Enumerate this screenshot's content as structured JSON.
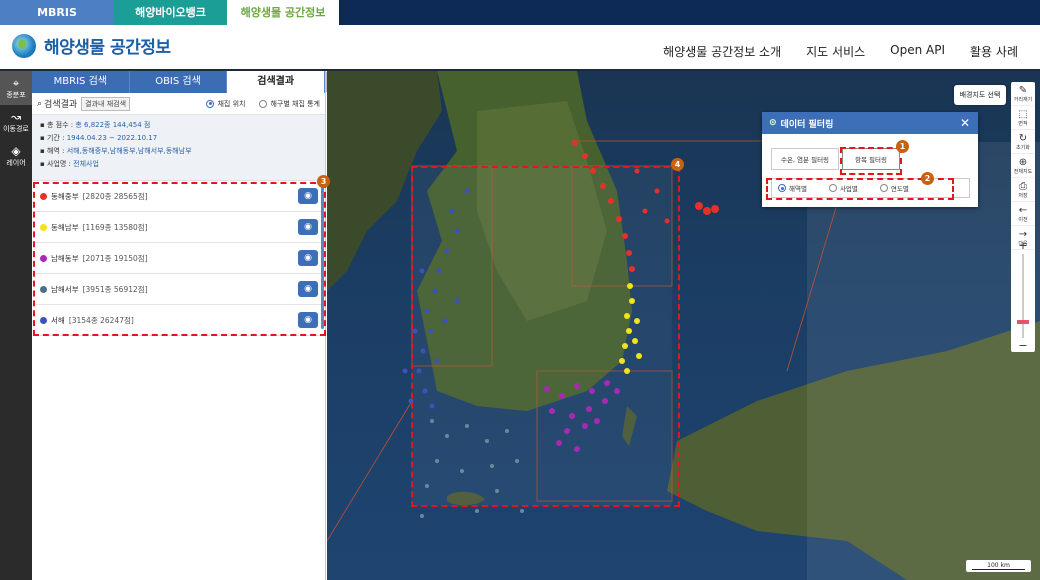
{
  "top_tabs": [
    "MBRIS",
    "해양바이오뱅크",
    "해양생물 공간정보"
  ],
  "logo_text": "해양생물 공간정보",
  "main_nav": [
    "해양생물 공간정보 소개",
    "지도 서비스",
    "Open API",
    "활용 사례"
  ],
  "rail": [
    {
      "label": "종분포",
      "icon": "map-pin-icon"
    },
    {
      "label": "이동경로",
      "icon": "route-icon"
    },
    {
      "label": "레이어",
      "icon": "layers-icon"
    }
  ],
  "panel": {
    "tabs": [
      "MBRIS 검색",
      "OBIS 검색",
      "검색결과"
    ],
    "search_label": "검색결과",
    "research_button": "결과내 재검색",
    "radio_options": [
      "채집 위치",
      "해구별 채집 통계"
    ],
    "summary": [
      {
        "label": "총 점수 : ",
        "value": "총 6,822종 144,454 점"
      },
      {
        "label": "기간 : ",
        "value": "1944.04.23 ~ 2022.10.17"
      },
      {
        "label": "해역 : ",
        "value": "서해,동해중부,남해동부,남해서부,동해남부"
      },
      {
        "label": "사업명 : ",
        "value": "전체사업"
      }
    ],
    "regions": [
      {
        "name": "동해중부",
        "count": "[2820종 28565점]",
        "color": "#e8302a"
      },
      {
        "name": "동해남부",
        "count": "[1169종 13580점]",
        "color": "#f2e31b"
      },
      {
        "name": "남해동부",
        "count": "[2071종 19150점]",
        "color": "#a52bb5"
      },
      {
        "name": "남해서부",
        "count": "[3951종 56912점]",
        "color": "#4a6f88"
      },
      {
        "name": "서해",
        "count": "[3154종 26247점]",
        "color": "#3d52b8"
      }
    ]
  },
  "map": {
    "basemap_button": "배경지도 선택",
    "tools": [
      {
        "label": "거리재기",
        "icon": "ruler-icon"
      },
      {
        "label": "면적",
        "icon": "area-icon"
      },
      {
        "label": "초기화",
        "icon": "refresh-icon"
      },
      {
        "label": "전체지도",
        "icon": "globe-icon"
      },
      {
        "label": "저장",
        "icon": "save-icon"
      },
      {
        "label": "이전",
        "icon": "arrow-left-icon"
      },
      {
        "label": "다음",
        "icon": "arrow-right-icon"
      }
    ],
    "scale": "100 km"
  },
  "filter_popup": {
    "title": "데이터 필터링",
    "tabs": [
      "수온, 염분 필터링",
      "항목 필터링"
    ],
    "options": [
      "해역별",
      "사업별",
      "연도별"
    ]
  },
  "badges": [
    "1",
    "2",
    "3",
    "4"
  ]
}
